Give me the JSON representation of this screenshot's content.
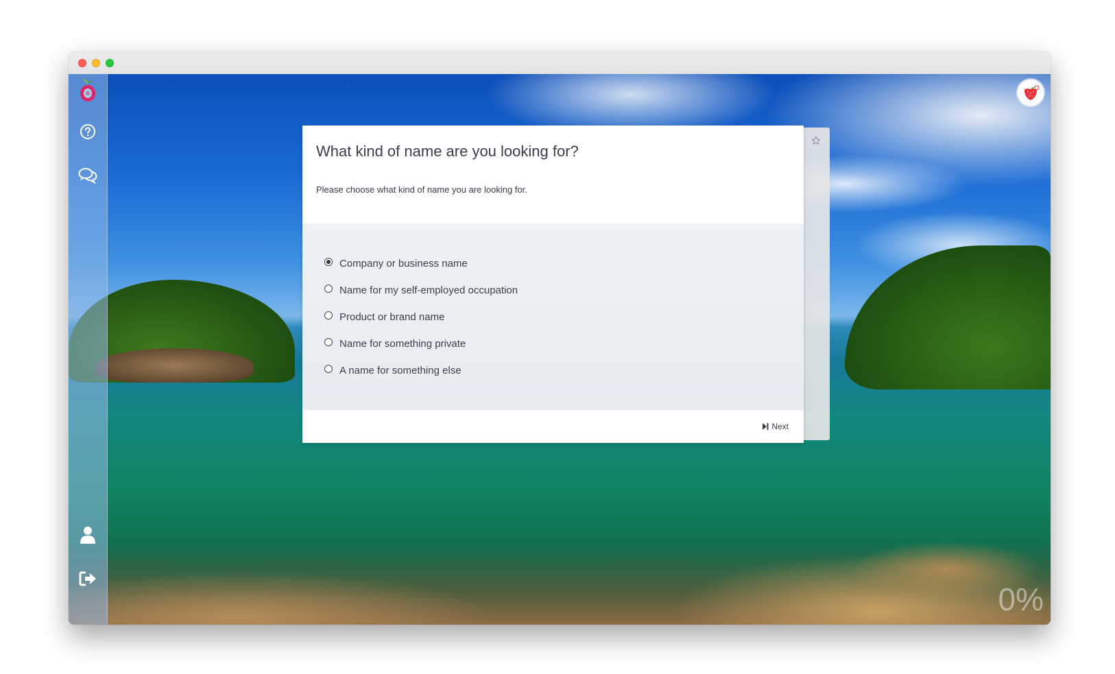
{
  "window": {
    "traffic_lights": [
      "close",
      "minimize",
      "maximize"
    ]
  },
  "sidebar": {
    "items": [
      {
        "name": "logo",
        "icon": "fruit-logo-icon"
      },
      {
        "name": "help",
        "icon": "question-circle-icon"
      },
      {
        "name": "chat",
        "icon": "chat-bubbles-icon"
      },
      {
        "name": "profile",
        "icon": "user-icon"
      },
      {
        "name": "logout",
        "icon": "sign-out-icon"
      }
    ]
  },
  "header": {
    "avatar_icon": "strawberry-avatar-icon"
  },
  "question": {
    "title": "What kind of name are you looking for?",
    "description": "Please choose what kind of name you are looking for.",
    "options": [
      {
        "label": "Company or business name",
        "checked": true
      },
      {
        "label": "Name for my self-employed occupation",
        "checked": false
      },
      {
        "label": "Product or brand name",
        "checked": false
      },
      {
        "label": "Name for something private",
        "checked": false
      },
      {
        "label": "A name for something else",
        "checked": false
      }
    ],
    "next_label": "Next"
  },
  "progress": {
    "text": "0%",
    "value": 0
  },
  "colors": {
    "accent": "#3b4048",
    "sidebar": "#96b9e6"
  }
}
